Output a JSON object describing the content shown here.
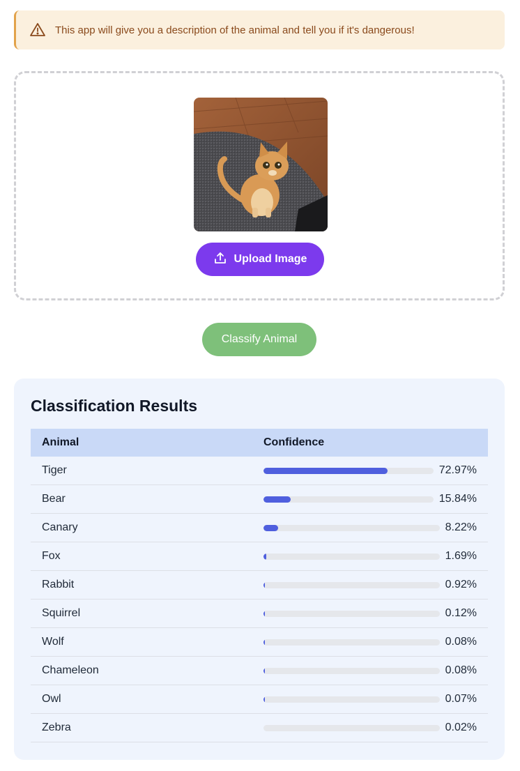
{
  "alert": {
    "text": "This app will give you a description of the animal and tell you if it's dangerous!",
    "icon": "warning-triangle-icon",
    "color": "#8a4a1c"
  },
  "upload": {
    "button_label": "Upload Image",
    "icon": "upload-icon",
    "accent": "#7c3aed"
  },
  "classify": {
    "button_label": "Classify Animal",
    "color": "#7ec07a"
  },
  "results": {
    "title": "Classification Results",
    "columns": [
      "Animal",
      "Confidence"
    ],
    "rows": [
      {
        "animal": "Tiger",
        "confidence": "72.97%",
        "value": 72.97
      },
      {
        "animal": "Bear",
        "confidence": "15.84%",
        "value": 15.84
      },
      {
        "animal": "Canary",
        "confidence": "8.22%",
        "value": 8.22
      },
      {
        "animal": "Fox",
        "confidence": "1.69%",
        "value": 1.69
      },
      {
        "animal": "Rabbit",
        "confidence": "0.92%",
        "value": 0.92
      },
      {
        "animal": "Squirrel",
        "confidence": "0.12%",
        "value": 0.12
      },
      {
        "animal": "Wolf",
        "confidence": "0.08%",
        "value": 0.08
      },
      {
        "animal": "Chameleon",
        "confidence": "0.08%",
        "value": 0.08
      },
      {
        "animal": "Owl",
        "confidence": "0.07%",
        "value": 0.07
      },
      {
        "animal": "Zebra",
        "confidence": "0.02%",
        "value": 0.02
      }
    ],
    "bar_color": "#4f5fde"
  }
}
